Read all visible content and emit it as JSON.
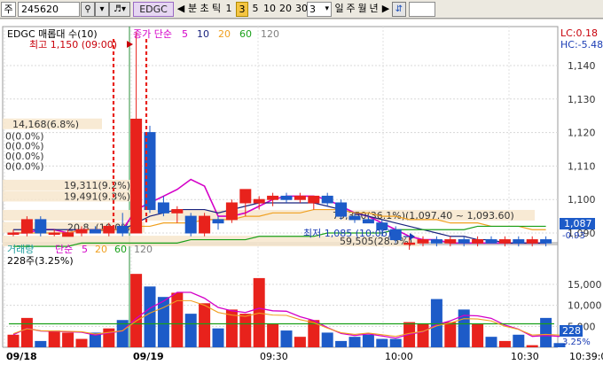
{
  "toolbar": {
    "market_label": "주",
    "code_value": "245620",
    "stock_badge": "EDGC",
    "chart_type": "분",
    "chart_type2": "초",
    "chart_type3": "틱",
    "period_buttons": [
      "1",
      "3",
      "5",
      "10",
      "20",
      "30"
    ],
    "active_period": "3",
    "interval_value": "3",
    "range_buttons": [
      "일",
      "주",
      "월",
      "년"
    ],
    "text_input_value": ""
  },
  "price_pane": {
    "title": "EDGC 매롭대 수(10)",
    "legend_ma": "종가 단순",
    "ma_periods": [
      "5",
      "10",
      "20",
      "60",
      "120"
    ],
    "high_label": "최고 1,150 (09:00)",
    "low_label": "최저 1,085 (10:06)",
    "lc_label": "LC:0.18",
    "hc_label": "HC:-5.48",
    "current_price": "1,087",
    "current_change": "-0.93",
    "volume_profile_labels": [
      "14,168(6.8%)",
      "0(0.0%)",
      "0(0.0%)",
      "0(0.0%)",
      "0(0.0%)",
      "19,311(9.2%)",
      "19,491(9.3%)",
      "20,8..(10.0%)",
      "75,350(36.1%)(1,097.40 ~ 1,093.60)",
      "59,505(28.5%)"
    ],
    "y_ticks": [
      "1,140",
      "1,130",
      "1,120",
      "1,110",
      "1,100",
      "1,090"
    ]
  },
  "volume_pane": {
    "title": "거래량",
    "legend_ma": "단순",
    "ma_periods": [
      "5",
      "20",
      "60",
      "120"
    ],
    "sub_label": "228주(3.25%)",
    "current_volume": "228",
    "current_pct": "3.25%",
    "y_ticks": [
      "15,000",
      "10,000",
      "5,000"
    ]
  },
  "time_axis": {
    "labels": [
      "09/18",
      "09/19",
      "09:30",
      "10:00",
      "10:30",
      "10:39:0"
    ]
  },
  "colors": {
    "up": "#e8221c",
    "down": "#1d5bc8",
    "ma5": "#d400c8",
    "ma10": "#1a237e",
    "ma20": "#f0a020",
    "ma60": "#1aa01a",
    "ma120": "#808080"
  },
  "chart_data": [
    {
      "type": "candlestick",
      "title": "EDGC",
      "unit": "KRW",
      "ylim": [
        1084,
        1147
      ],
      "candles": [
        {
          "o": 1090,
          "h": 1091,
          "l": 1089,
          "c": 1090
        },
        {
          "o": 1090,
          "h": 1095,
          "l": 1089,
          "c": 1094
        },
        {
          "o": 1094,
          "h": 1095,
          "l": 1089,
          "c": 1090
        },
        {
          "o": 1090,
          "h": 1091,
          "l": 1089,
          "c": 1090
        },
        {
          "o": 1089,
          "h": 1091,
          "l": 1089,
          "c": 1090
        },
        {
          "o": 1090,
          "h": 1092,
          "l": 1089,
          "c": 1091
        },
        {
          "o": 1091,
          "h": 1092,
          "l": 1090,
          "c": 1090
        },
        {
          "o": 1090,
          "h": 1093,
          "l": 1089,
          "c": 1092
        },
        {
          "o": 1092,
          "h": 1096,
          "l": 1089,
          "c": 1090
        },
        {
          "o": 1090,
          "h": 1150,
          "l": 1090,
          "c": 1124
        },
        {
          "o": 1120,
          "h": 1122,
          "l": 1096,
          "c": 1097
        },
        {
          "o": 1099,
          "h": 1101,
          "l": 1095,
          "c": 1096
        },
        {
          "o": 1096,
          "h": 1098,
          "l": 1093,
          "c": 1097
        },
        {
          "o": 1095,
          "h": 1096,
          "l": 1089,
          "c": 1090
        },
        {
          "o": 1090,
          "h": 1096,
          "l": 1089,
          "c": 1095
        },
        {
          "o": 1094,
          "h": 1095,
          "l": 1091,
          "c": 1093
        },
        {
          "o": 1094,
          "h": 1100,
          "l": 1093,
          "c": 1099
        },
        {
          "o": 1099,
          "h": 1103,
          "l": 1095,
          "c": 1103
        },
        {
          "o": 1099,
          "h": 1101,
          "l": 1097,
          "c": 1100
        },
        {
          "o": 1100,
          "h": 1102,
          "l": 1098,
          "c": 1101
        },
        {
          "o": 1101,
          "h": 1102,
          "l": 1099,
          "c": 1100
        },
        {
          "o": 1100,
          "h": 1102,
          "l": 1099,
          "c": 1101
        },
        {
          "o": 1099,
          "h": 1101,
          "l": 1097,
          "c": 1101
        },
        {
          "o": 1101,
          "h": 1102,
          "l": 1098,
          "c": 1099
        },
        {
          "o": 1099,
          "h": 1100,
          "l": 1094,
          "c": 1095
        },
        {
          "o": 1095,
          "h": 1096,
          "l": 1093,
          "c": 1094
        },
        {
          "o": 1094,
          "h": 1095,
          "l": 1093,
          "c": 1093
        },
        {
          "o": 1093,
          "h": 1094,
          "l": 1089,
          "c": 1091
        },
        {
          "o": 1091,
          "h": 1092,
          "l": 1087,
          "c": 1088
        },
        {
          "o": 1087,
          "h": 1089,
          "l": 1085,
          "c": 1087
        },
        {
          "o": 1087,
          "h": 1089,
          "l": 1086,
          "c": 1088
        },
        {
          "o": 1088,
          "h": 1089,
          "l": 1086,
          "c": 1087
        },
        {
          "o": 1087,
          "h": 1089,
          "l": 1086,
          "c": 1088
        },
        {
          "o": 1088,
          "h": 1089,
          "l": 1086,
          "c": 1087
        },
        {
          "o": 1087,
          "h": 1089,
          "l": 1086,
          "c": 1088
        },
        {
          "o": 1088,
          "h": 1089,
          "l": 1087,
          "c": 1087
        },
        {
          "o": 1087,
          "h": 1089,
          "l": 1086,
          "c": 1088
        },
        {
          "o": 1088,
          "h": 1089,
          "l": 1086,
          "c": 1087
        },
        {
          "o": 1087,
          "h": 1089,
          "l": 1086,
          "c": 1088
        },
        {
          "o": 1088,
          "h": 1089,
          "l": 1086,
          "c": 1087
        }
      ],
      "ma_series": [
        {
          "period": "5",
          "values": [
            1090,
            1090,
            1091,
            1091,
            1090,
            1091,
            1091,
            1091,
            1091,
            1097,
            1099,
            1101,
            1103,
            1106,
            1104,
            1095,
            1095,
            1096,
            1098,
            1100,
            1101,
            1101,
            1101,
            1100,
            1098,
            1096,
            1095,
            1093,
            1091,
            1089,
            1088,
            1088,
            1087,
            1087,
            1087,
            1087,
            1087,
            1087,
            1087,
            1087
          ]
        },
        {
          "period": "10",
          "values": [
            1091,
            1091,
            1091,
            1091,
            1091,
            1091,
            1091,
            1091,
            1091,
            1093,
            1095,
            1096,
            1097,
            1097,
            1097,
            1096,
            1097,
            1098,
            1099,
            1099,
            1099,
            1099,
            1099,
            1098,
            1097,
            1096,
            1095,
            1094,
            1093,
            1092,
            1091,
            1090,
            1089,
            1089,
            1088,
            1088,
            1087,
            1087,
            1087,
            1087
          ]
        },
        {
          "period": "20",
          "values": [
            1090,
            1090,
            1090,
            1090,
            1090,
            1091,
            1091,
            1091,
            1091,
            1092,
            1092,
            1093,
            1093,
            1093,
            1094,
            1094,
            1094,
            1095,
            1095,
            1096,
            1096,
            1096,
            1097,
            1097,
            1097,
            1096,
            1096,
            1095,
            1095,
            1094,
            1094,
            1094,
            1093,
            1093,
            1093,
            1092,
            1092,
            1092,
            1091,
            1091
          ]
        },
        {
          "period": "60",
          "values": [
            1086,
            1086,
            1086,
            1086,
            1086,
            1087,
            1087,
            1087,
            1087,
            1087,
            1087,
            1087,
            1087,
            1088,
            1088,
            1088,
            1088,
            1088,
            1089,
            1089,
            1089,
            1089,
            1089,
            1090,
            1090,
            1090,
            1090,
            1090,
            1091,
            1091,
            1091,
            1091,
            1091,
            1091,
            1092,
            1092,
            1092,
            1092,
            1092,
            1092
          ]
        }
      ]
    },
    {
      "type": "bar",
      "title": "거래량",
      "ylim": [
        0,
        18500
      ],
      "values": [
        3000,
        7000,
        1500,
        4000,
        3500,
        2000,
        3500,
        4500,
        6500,
        17500,
        14500,
        12000,
        13000,
        8000,
        10500,
        4500,
        9000,
        8000,
        16500,
        5500,
        4000,
        2500,
        6500,
        3500,
        1500,
        2500,
        3000,
        2000,
        2000,
        6000,
        5500,
        11500,
        6000,
        9000,
        5500,
        2500,
        1500,
        3000,
        500,
        7000,
        1000
      ],
      "ma_values": [
        3000,
        4500,
        3900,
        3800,
        3700,
        3600,
        2900,
        3400,
        3900,
        6900,
        9300,
        11000,
        13100,
        13100,
        11700,
        9500,
        8700,
        8300,
        9300,
        8700,
        8600,
        7300,
        6400,
        4700,
        3300,
        2800,
        3200,
        2700,
        2200,
        3100,
        3700,
        5400,
        6300,
        7600,
        7500,
        6900,
        5300,
        4300,
        2600,
        2800,
        2600
      ]
    }
  ]
}
